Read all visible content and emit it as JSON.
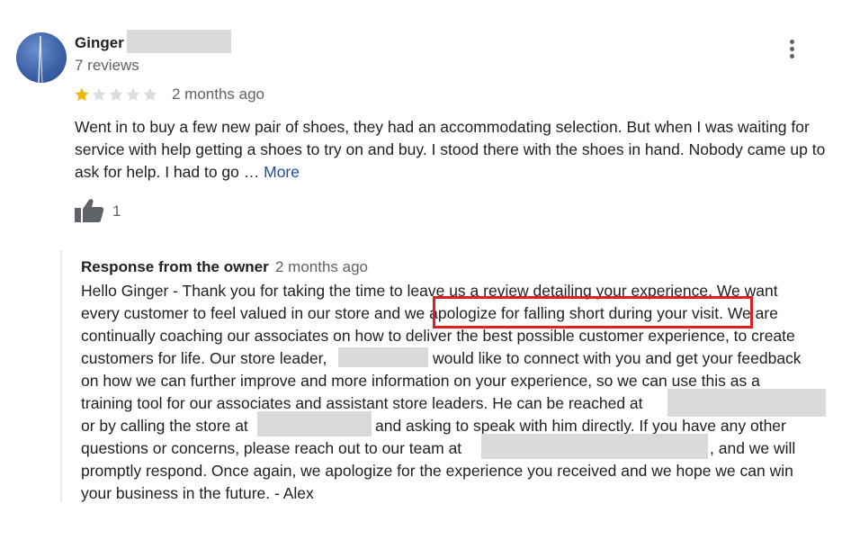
{
  "review": {
    "reviewer_name": "Ginger",
    "review_count": "7 reviews",
    "rating": 1,
    "rating_max": 5,
    "date": "2 months ago",
    "text": "Went in to buy a few new pair of shoes, they had an accommodating selection. But when I was waiting for service with help getting a shoes to try on and buy. I stood there with the shoes in hand. Nobody came up to ask for help. I had to go … ",
    "more_label": "More",
    "likes": "1",
    "colors": {
      "star_filled": "#f4b400",
      "star_empty": "#dadce0",
      "more_link": "#1a4ea5",
      "secondary_text": "#5f6368"
    }
  },
  "owner_response": {
    "label": "Response from the owner",
    "date": "2 months ago",
    "lines": [
      "Hello Ginger - Thank you for taking the time to leave us a review detailing your experience. We want",
      "every customer to feel valued in our store and we apologize for falling short during your visit. We are",
      "continually coaching our associates on how to deliver the best possible customer experience, to create",
      "customers for life. Our store leader,",
      "would like to connect with you and get your feedback",
      "on how we can further improve and more information on your experience, so we can use this as a",
      "training tool for our associates and assistant store leaders. He can be reached at",
      "or by calling the store at",
      "and asking to speak with him directly. If you have any other",
      "questions or concerns, please reach out to our team at",
      ", and we will",
      "promptly respond. Once again, we apologize for the experience you received and we hope we can win",
      "your business in the future. - Alex"
    ],
    "highlight_color": "#e02020"
  }
}
